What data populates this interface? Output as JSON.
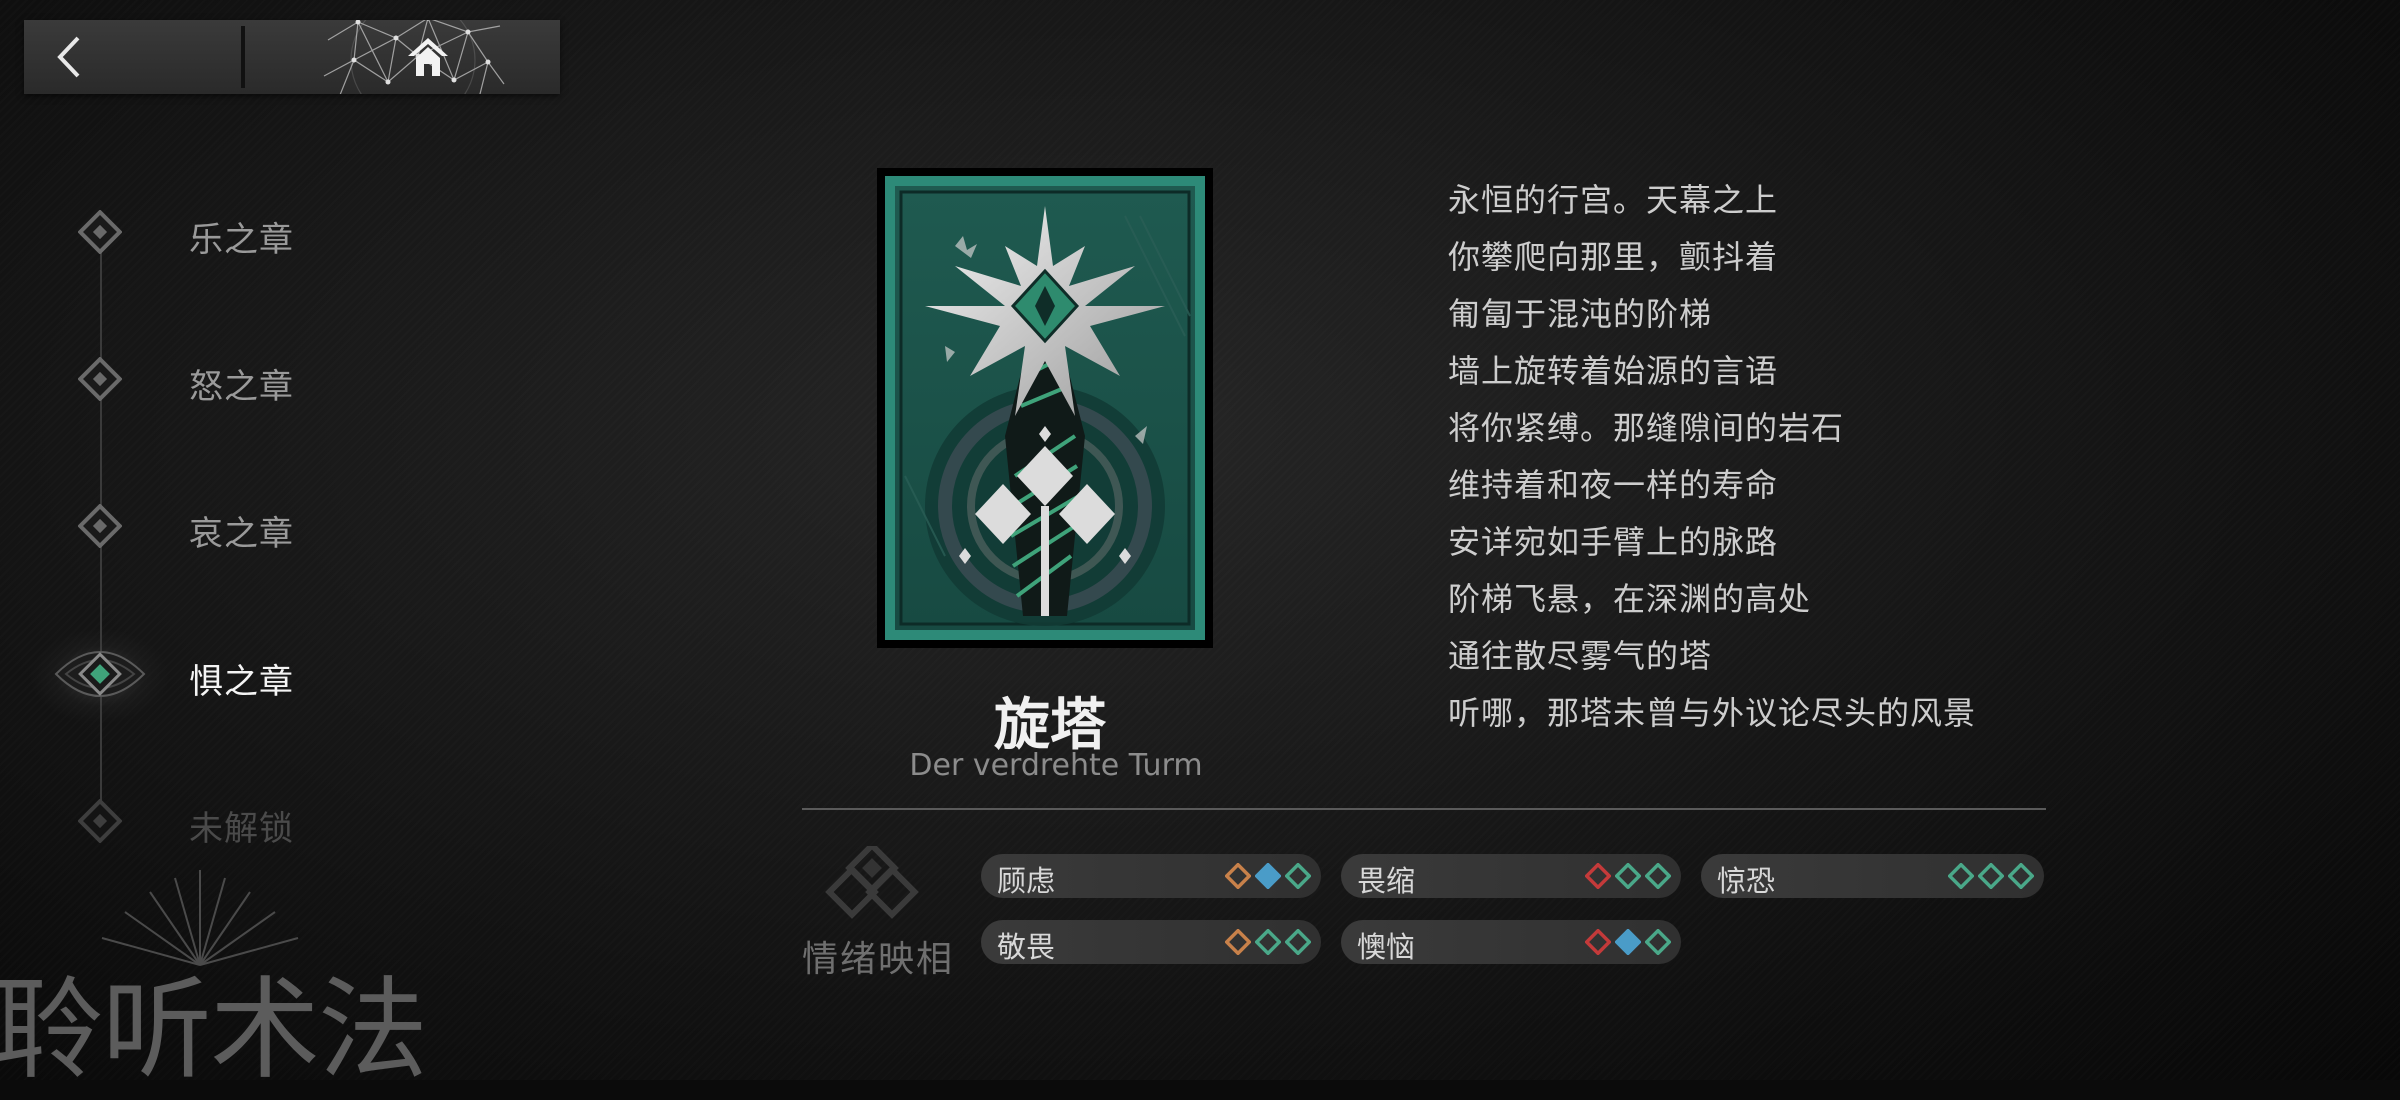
{
  "nav": {
    "back_icon": "chevron-left-icon",
    "home_icon": "home-icon"
  },
  "chapters": [
    {
      "label": "乐之章",
      "state": "normal"
    },
    {
      "label": "怒之章",
      "state": "normal"
    },
    {
      "label": "哀之章",
      "state": "normal"
    },
    {
      "label": "惧之章",
      "state": "active"
    },
    {
      "label": "未解锁",
      "state": "locked"
    }
  ],
  "brand": {
    "text": "聆听术法"
  },
  "card": {
    "title": "旋塔",
    "subtitle": "Der verdrehte Turm"
  },
  "poem": [
    "永恒的行宫。天幕之上",
    "你攀爬向那里，颤抖着",
    "匍匐于混沌的阶梯",
    "墙上旋转着始源的言语",
    "将你紧缚。那缝隙间的岩石",
    "维持着和夜一样的寿命",
    "安详宛如手臂上的脉路",
    "阶梯飞悬，在深渊的高处",
    "通往散尽雾气的塔",
    "听哪，那塔未曾与外议论尽头的风景"
  ],
  "emotions": {
    "title": "情绪映相",
    "tags": [
      {
        "label": "顾虑",
        "gems": [
          "orange",
          "blue",
          "green"
        ]
      },
      {
        "label": "畏缩",
        "gems": [
          "red",
          "green",
          "green"
        ]
      },
      {
        "label": "惊恐",
        "gems": [
          "green",
          "green",
          "green"
        ]
      },
      {
        "label": "敬畏",
        "gems": [
          "orange",
          "green",
          "green"
        ]
      },
      {
        "label": "懊恼",
        "gems": [
          "red",
          "blue",
          "green"
        ]
      }
    ]
  },
  "colors": {
    "accent_green": "#3fa37a",
    "gem_orange": "#c8814a",
    "gem_blue": "#4a9cc8",
    "gem_green": "#4aa889",
    "gem_red": "#c43a3a"
  }
}
